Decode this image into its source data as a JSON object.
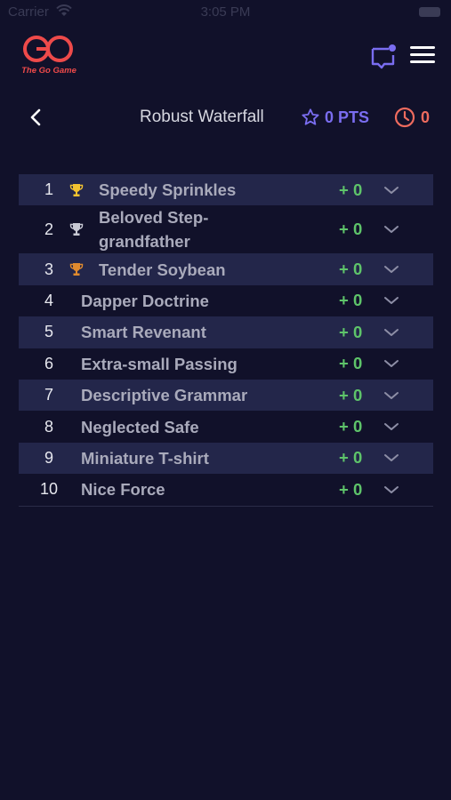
{
  "status_bar": {
    "carrier": "Carrier",
    "time": "3:05 PM"
  },
  "header": {
    "brand": "The Go Game"
  },
  "subheader": {
    "title": "Robust Waterfall",
    "points": "0 PTS",
    "timer": "0"
  },
  "colors": {
    "background": "#11112a",
    "row_shade": "#23264a",
    "accent_red": "#ee4a4a",
    "points_purple": "#7a6df0",
    "score_green": "#5ec46a",
    "gold": "#f2c230",
    "silver": "#c8c9d4",
    "bronze": "#e08a2e"
  },
  "leaderboard": [
    {
      "rank": "1",
      "name": "Speedy Sprinkles",
      "score": "+ 0",
      "trophy": "gold-trophy-icon"
    },
    {
      "rank": "2",
      "name": "Beloved Step-grandfather",
      "score": "+ 0",
      "trophy": "silver-trophy-icon"
    },
    {
      "rank": "3",
      "name": "Tender Soybean",
      "score": "+ 0",
      "trophy": "bronze-trophy-icon"
    },
    {
      "rank": "4",
      "name": "Dapper Doctrine",
      "score": "+ 0"
    },
    {
      "rank": "5",
      "name": "Smart Revenant",
      "score": "+ 0"
    },
    {
      "rank": "6",
      "name": "Extra-small Passing",
      "score": "+ 0"
    },
    {
      "rank": "7",
      "name": "Descriptive Grammar",
      "score": "+ 0"
    },
    {
      "rank": "8",
      "name": "Neglected Safe",
      "score": "+ 0"
    },
    {
      "rank": "9",
      "name": "Miniature T-shirt",
      "score": "+ 0"
    },
    {
      "rank": "10",
      "name": "Nice Force",
      "score": "+ 0"
    }
  ]
}
